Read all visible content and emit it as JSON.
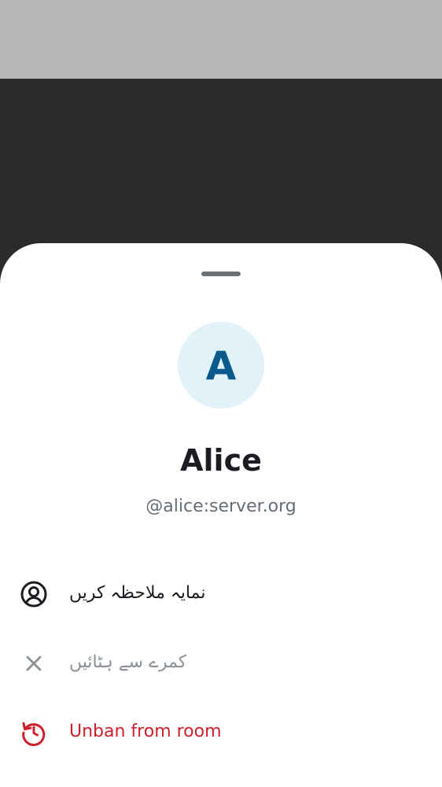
{
  "backdrop": {
    "top_strip_color": "#b7b8ba",
    "scrim_color": "#2a2b2d"
  },
  "sheet": {
    "background": "#ffffff",
    "handle_color": "#6e7277"
  },
  "profile": {
    "avatar_letter": "A",
    "avatar_bg": "#e1f2f8",
    "avatar_fg": "#0b5a8c",
    "display_name": "Alice",
    "user_id": "@alice:server.org"
  },
  "actions": [
    {
      "label": "نمایہ ملاحظہ کریں",
      "icon": "user-circle-icon",
      "color": "#1b1d22",
      "enabled": true
    },
    {
      "label": "کمرے سے ہٹائیں",
      "icon": "close-icon",
      "color": "#8b9199",
      "enabled": false
    },
    {
      "label": "Unban from room",
      "icon": "undo-rotate-icon",
      "color": "#d0202b",
      "enabled": true
    }
  ]
}
